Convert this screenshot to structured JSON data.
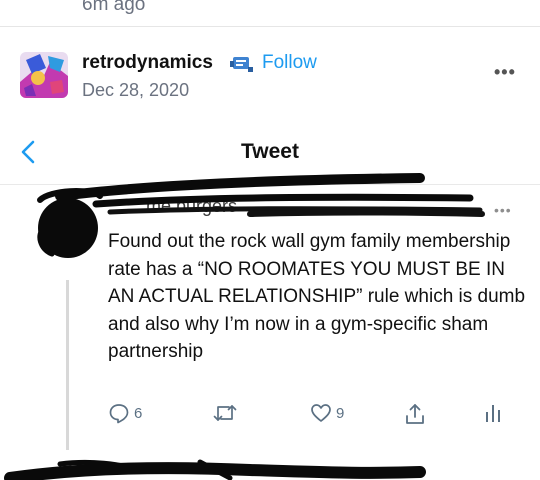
{
  "post": {
    "time_ago": "6m ago",
    "username": "retrodynamics",
    "follow_label": "Follow",
    "date": "Dec 28, 2020"
  },
  "nav": {
    "title": "Tweet"
  },
  "tweet": {
    "author_visible_fragment": "me burgers",
    "text": "Found out the rock wall gym family membership rate has a “NO ROOMATES YOU MUST BE IN AN ACTUAL RELATIONSHIP” rule which is dumb and also why I’m now in a gym-specific sham partnership",
    "replies": "6",
    "likes": "9"
  },
  "icons": {
    "more": "more-horizontal-icon",
    "back": "chevron-left-icon",
    "reply": "reply-icon",
    "retweet": "retweet-icon",
    "like": "heart-icon",
    "share": "share-icon",
    "stats": "stats-icon",
    "verified": "verified-badge-icon"
  },
  "colors": {
    "accent": "#1d9bf0",
    "muted": "#5b7083"
  }
}
